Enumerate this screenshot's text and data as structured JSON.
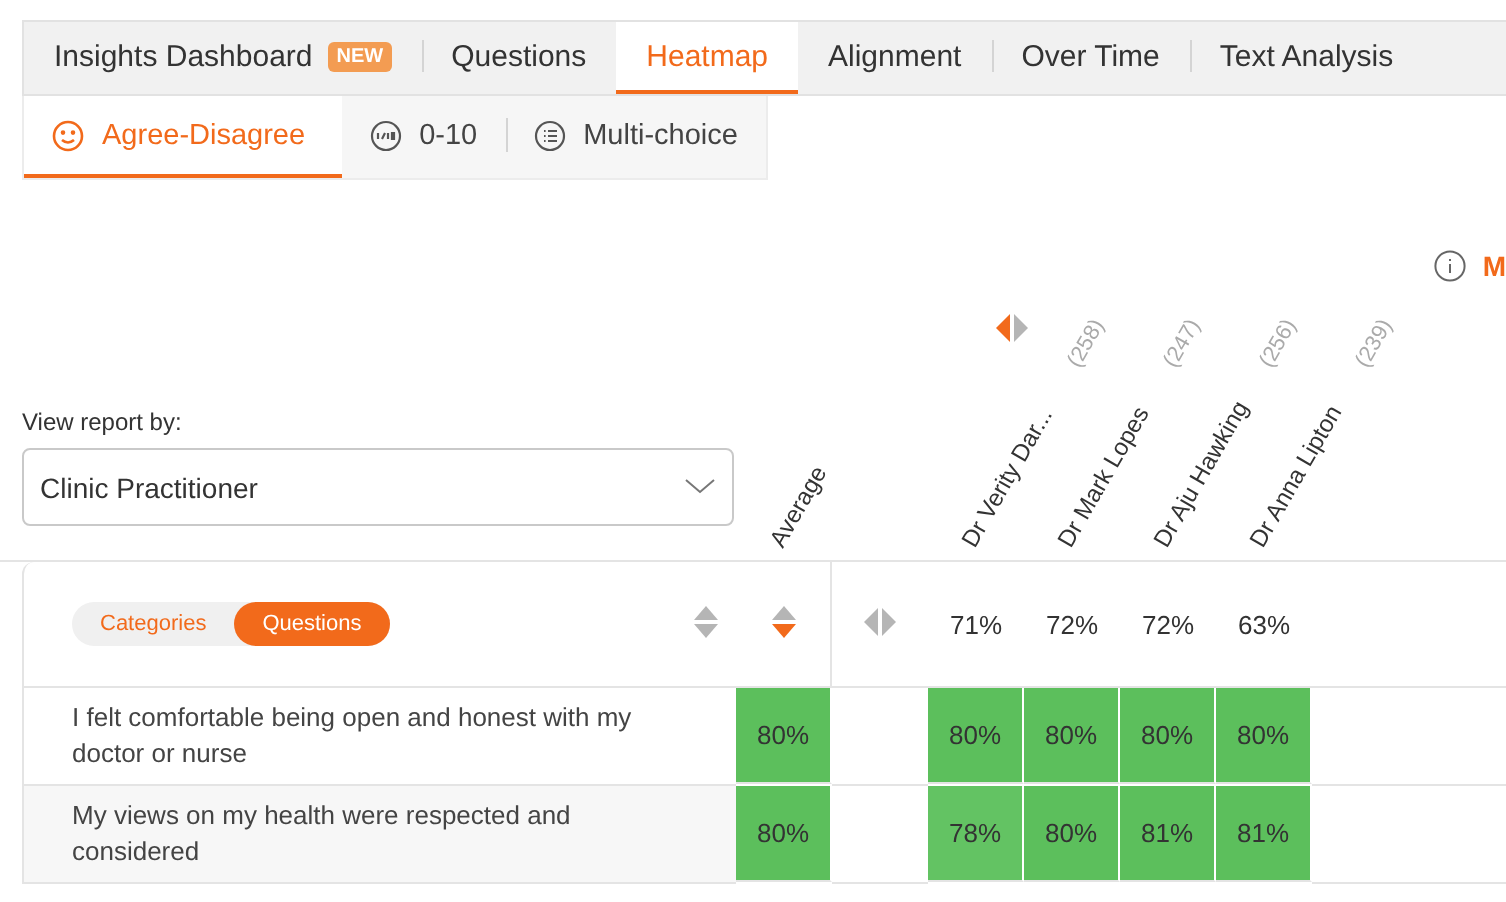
{
  "tabs": [
    {
      "label": "Insights Dashboard",
      "badge": "NEW",
      "selected": false
    },
    {
      "label": "Questions",
      "selected": false
    },
    {
      "label": "Heatmap",
      "selected": true
    },
    {
      "label": "Alignment",
      "selected": false
    },
    {
      "label": "Over Time",
      "selected": false
    },
    {
      "label": "Text Analysis",
      "selected": false
    }
  ],
  "subtabs": [
    {
      "label": "Agree-Disagree",
      "kind": "smiley",
      "selected": true
    },
    {
      "label": "0-10",
      "kind": "scale",
      "selected": false
    },
    {
      "label": "Multi-choice",
      "kind": "list",
      "selected": false
    }
  ],
  "info_link": "M",
  "view_report": {
    "label": "View report by:",
    "value": "Clinic Practitioner"
  },
  "heatmap": {
    "practitioner_sorted_left": true,
    "toggle": [
      {
        "label": "Categories",
        "selected": false
      },
      {
        "label": "Questions",
        "selected": true
      }
    ],
    "average": {
      "label": "Average",
      "sorted_descending": true
    },
    "practitioners": [
      {
        "name": "Dr Verity Dar...",
        "count": "(258)",
        "overall": "71%"
      },
      {
        "name": "Dr Mark Lopes",
        "count": "(247)",
        "overall": "72%"
      },
      {
        "name": "Dr Aju Hawking",
        "count": "(256)",
        "overall": "72%"
      },
      {
        "name": "Dr Anna Lipton",
        "count": "(239)",
        "overall": "63%"
      }
    ],
    "rows": [
      {
        "question": "I felt comfortable being open and honest with my doctor or nurse",
        "average": {
          "value": "80%",
          "color": "#5cbf5c"
        },
        "cells": [
          {
            "value": "80%",
            "color": "#5cbf5c"
          },
          {
            "value": "80%",
            "color": "#5cbf5c"
          },
          {
            "value": "80%",
            "color": "#5cbf5c"
          },
          {
            "value": "80%",
            "color": "#5cbf5c"
          }
        ]
      },
      {
        "question": "My views on my health were respected and considered",
        "average": {
          "value": "80%",
          "color": "#5cbf5c"
        },
        "cells": [
          {
            "value": "78%",
            "color": "#63c363"
          },
          {
            "value": "80%",
            "color": "#5cbf5c"
          },
          {
            "value": "81%",
            "color": "#5cbf5c"
          },
          {
            "value": "81%",
            "color": "#5cbf5c"
          }
        ]
      }
    ]
  }
}
